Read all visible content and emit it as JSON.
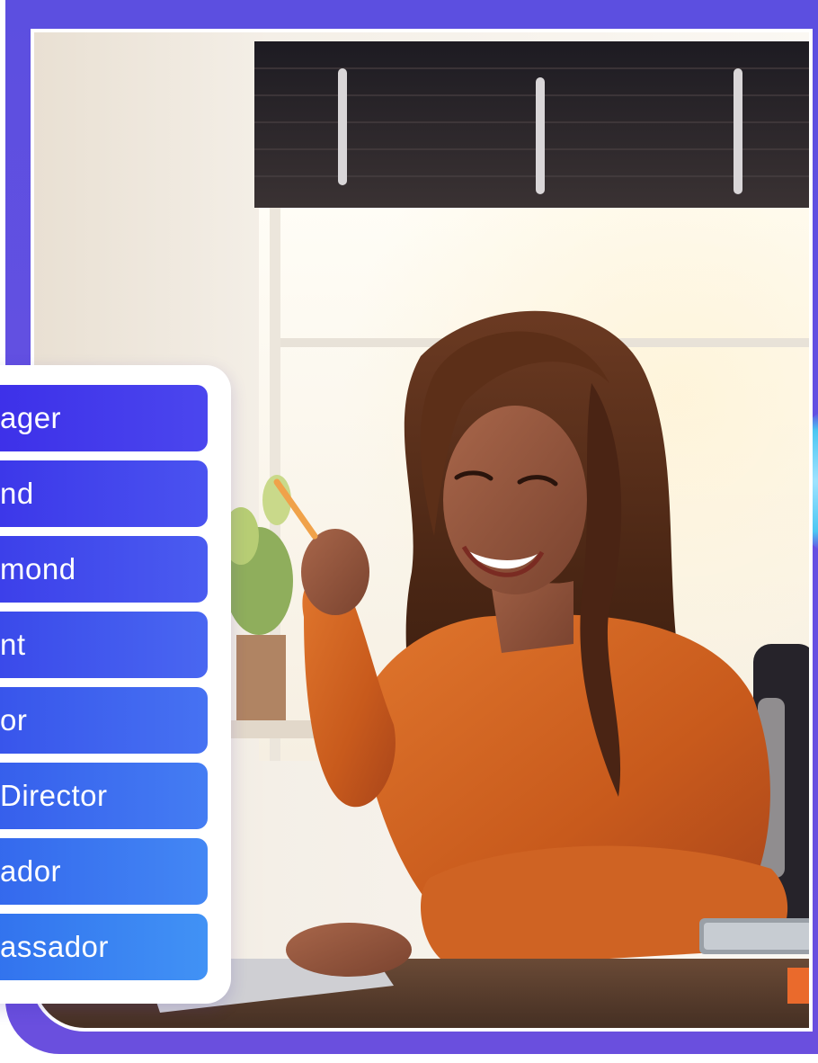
{
  "colors": {
    "frame_purple": "#5c4fe0",
    "accent_cyan": "#4cc7f2",
    "label_gradient_top": "#3b2ee6",
    "label_gradient_bottom": "#2f7ff2"
  },
  "photo": {
    "icon": "woman-at-desk-photo"
  },
  "rank_card": {
    "items": [
      {
        "label": "ager",
        "color_start": "#3b2de8",
        "color_end": "#4b46ee"
      },
      {
        "label": "nd",
        "color_start": "#3a33e8",
        "color_end": "#4a53f0"
      },
      {
        "label": "mond",
        "color_start": "#3a3be9",
        "color_end": "#4a5cf0"
      },
      {
        "label": "nt",
        "color_start": "#3845e9",
        "color_end": "#4967f1"
      },
      {
        "label": "or",
        "color_start": "#3650ea",
        "color_end": "#4672f2"
      },
      {
        "label": "Director",
        "color_start": "#345aeb",
        "color_end": "#447df3"
      },
      {
        "label": "ador",
        "color_start": "#3264ec",
        "color_end": "#4387f4"
      },
      {
        "label": "assador",
        "color_start": "#306eed",
        "color_end": "#4192f5"
      }
    ]
  }
}
